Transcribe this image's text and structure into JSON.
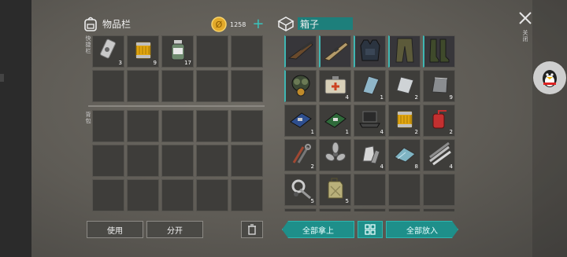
{
  "inventory": {
    "title": "物品栏",
    "coins": "1258",
    "hotbar_label": "快捷栏",
    "backpack_label": "背包",
    "hotbar": [
      {
        "name": "duct-tape-icon",
        "count": "3"
      },
      {
        "name": "oil-filter-icon",
        "count": "9"
      },
      {
        "name": "pills-bottle-icon",
        "count": "17"
      },
      {
        "name": "empty",
        "count": ""
      },
      {
        "name": "empty",
        "count": ""
      },
      {
        "name": "empty",
        "count": ""
      },
      {
        "name": "empty",
        "count": ""
      },
      {
        "name": "empty",
        "count": ""
      },
      {
        "name": "empty",
        "count": ""
      },
      {
        "name": "empty",
        "count": ""
      }
    ]
  },
  "box": {
    "title": "箱子",
    "items": [
      {
        "name": "shotgun-icon",
        "count": ""
      },
      {
        "name": "rifle-icon",
        "count": ""
      },
      {
        "name": "armor-vest-icon",
        "count": ""
      },
      {
        "name": "pants-icon",
        "count": ""
      },
      {
        "name": "boots-icon",
        "count": ""
      },
      {
        "name": "gas-mask-icon",
        "count": ""
      },
      {
        "name": "medkit-icon",
        "count": "4"
      },
      {
        "name": "glass-sheet-icon",
        "count": "1"
      },
      {
        "name": "metal-sheet-icon",
        "count": "2"
      },
      {
        "name": "steel-plate-icon",
        "count": "9"
      },
      {
        "name": "circuit-board-blue-icon",
        "count": "1"
      },
      {
        "name": "circuit-board-green-icon",
        "count": "1"
      },
      {
        "name": "laptop-icon",
        "count": "4"
      },
      {
        "name": "oil-filter-icon",
        "count": "2"
      },
      {
        "name": "red-canister-icon",
        "count": "2"
      },
      {
        "name": "tools-icon",
        "count": "2"
      },
      {
        "name": "propeller-icon",
        "count": ""
      },
      {
        "name": "metal-scraps-icon",
        "count": "4"
      },
      {
        "name": "glass-pile-icon",
        "count": "8"
      },
      {
        "name": "pipes-icon",
        "count": "4"
      },
      {
        "name": "parts-bundle-icon",
        "count": "5"
      },
      {
        "name": "jerrycan-icon",
        "count": "5"
      },
      {
        "name": "empty",
        "count": ""
      },
      {
        "name": "empty",
        "count": ""
      },
      {
        "name": "empty",
        "count": ""
      }
    ]
  },
  "buttons": {
    "use": "使用",
    "split": "分开",
    "take_all": "全部拿上",
    "put_all": "全部放入",
    "close": "关闭"
  },
  "colors": {
    "accent": "#1e8f8a",
    "slot": "#3e3d3a"
  }
}
